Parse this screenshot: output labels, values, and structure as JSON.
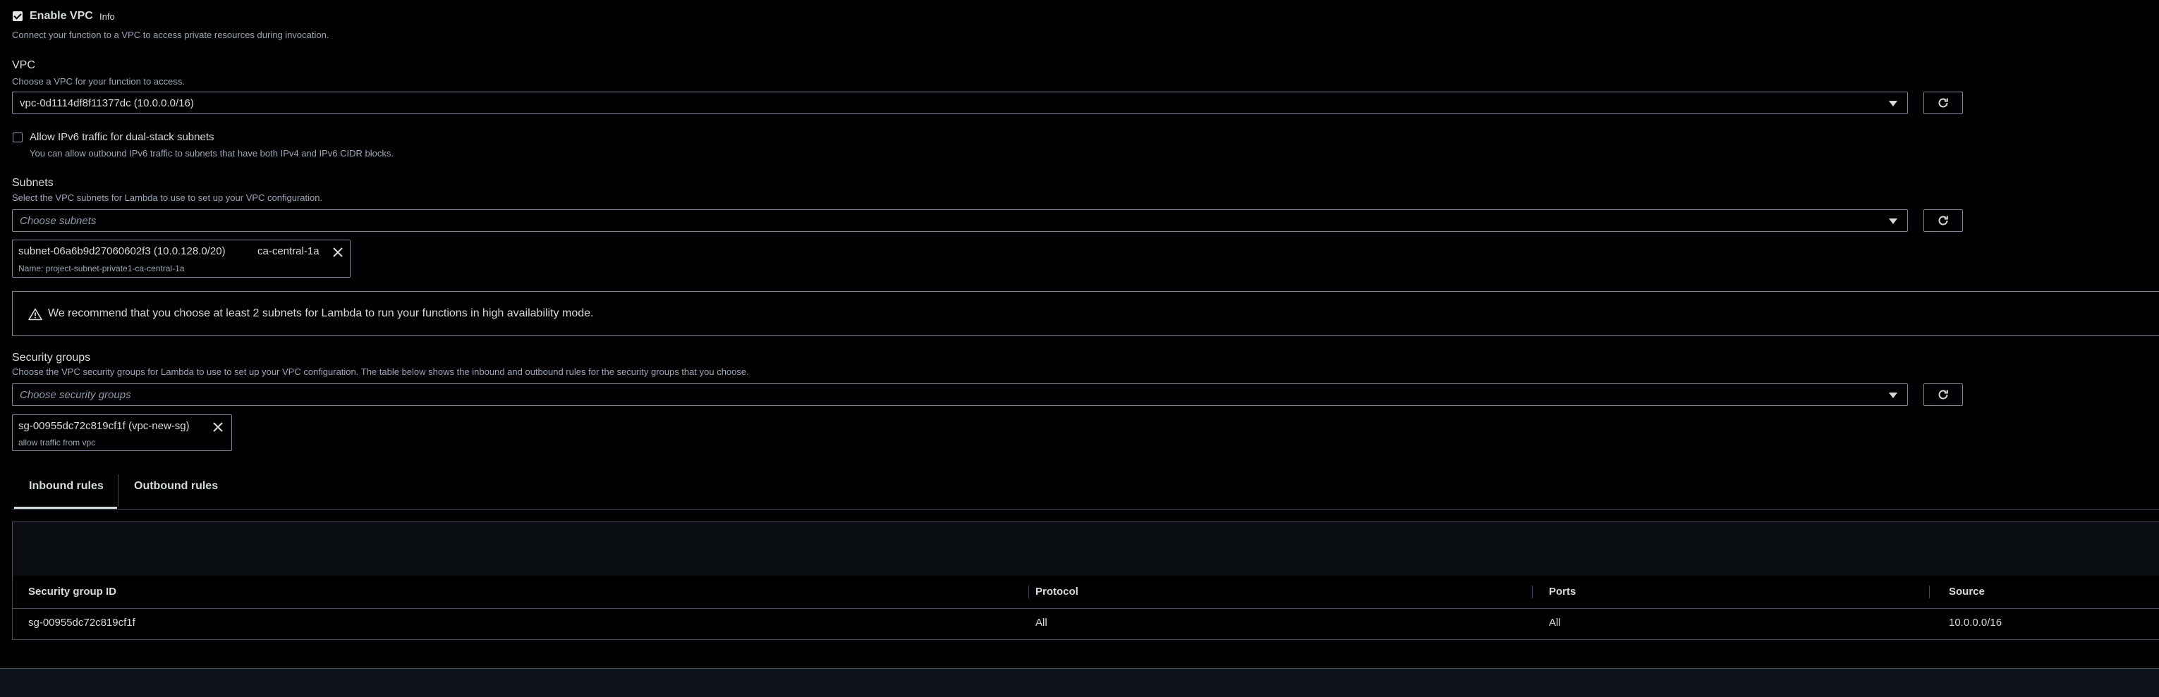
{
  "enable_vpc": {
    "label": "Enable VPC",
    "info": "Info",
    "checked": true,
    "description": "Connect your function to a VPC to access private resources during invocation."
  },
  "vpc": {
    "label": "VPC",
    "description": "Choose a VPC for your function to access.",
    "value": "vpc-0d1114df8f11377dc (10.0.0.0/16)"
  },
  "ipv6": {
    "label": "Allow IPv6 traffic for dual-stack subnets",
    "checked": false,
    "description": "You can allow outbound IPv6 traffic to subnets that have both IPv4 and IPv6 CIDR blocks."
  },
  "subnets": {
    "label": "Subnets",
    "description": "Select the VPC subnets for Lambda to use to set up your VPC configuration.",
    "placeholder": "Choose subnets",
    "token": {
      "id": "subnet-06a6b9d27060602f3 (10.0.128.0/20)",
      "az": "ca-central-1a",
      "name": "Name: project-subnet-private1-ca-central-1a"
    }
  },
  "alert": {
    "icon": "warning-icon",
    "text": "We recommend that you choose at least 2 subnets for Lambda to run your functions in high availability mode."
  },
  "security_groups": {
    "label": "Security groups",
    "description": "Choose the VPC security groups for Lambda to use to set up your VPC configuration. The table below shows the inbound and outbound rules for the security groups that you choose.",
    "placeholder": "Choose security groups",
    "token": {
      "id": "sg-00955dc72c819cf1f (vpc-new-sg)",
      "desc": "allow traffic from vpc"
    }
  },
  "tabs": [
    {
      "label": "Inbound rules",
      "active": true
    },
    {
      "label": "Outbound rules",
      "active": false
    }
  ],
  "table": {
    "headers": [
      "Security group ID",
      "Protocol",
      "Ports",
      "Source"
    ],
    "rows": [
      [
        "sg-00955dc72c819cf1f",
        "All",
        "All",
        "10.0.0.0/16"
      ]
    ]
  },
  "colors": {
    "background": "#000000",
    "text": "#d5dbdb",
    "muted": "#9ba7b6",
    "border": "#7d8998",
    "active_tab_underline": "#d5dbdb"
  }
}
